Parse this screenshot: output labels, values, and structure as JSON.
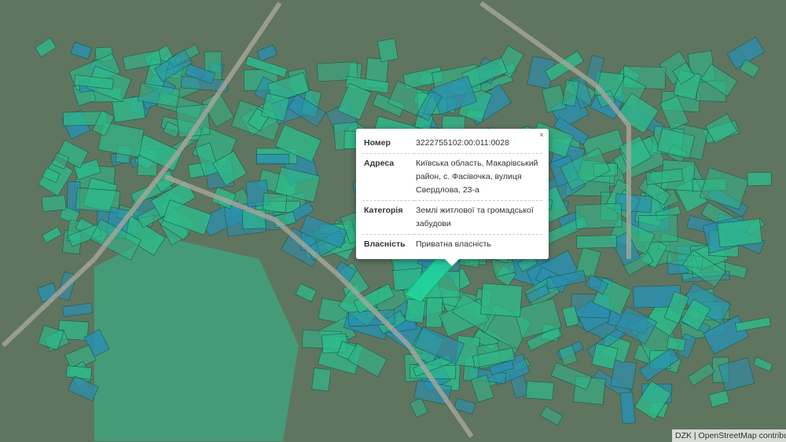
{
  "popup": {
    "close": "×",
    "rows": [
      {
        "label": "Номер",
        "value": "3222755102:00:011:0028"
      },
      {
        "label": "Адреса",
        "value": "Київська область, Макарівський район, с. Фасівочка, вулиця Свердлова, 23-а"
      },
      {
        "label": "Категорія",
        "value": "Землі житлової та громадської забудови"
      },
      {
        "label": "Власність",
        "value": "Приватна власність"
      }
    ]
  },
  "attribution": "DZK | OpenStreetMap contributors",
  "colors": {
    "parcel_green": "#2fb98a",
    "parcel_blue": "#2a8fb0",
    "highlight": "#22d6a0",
    "ground": "#5f7560"
  }
}
